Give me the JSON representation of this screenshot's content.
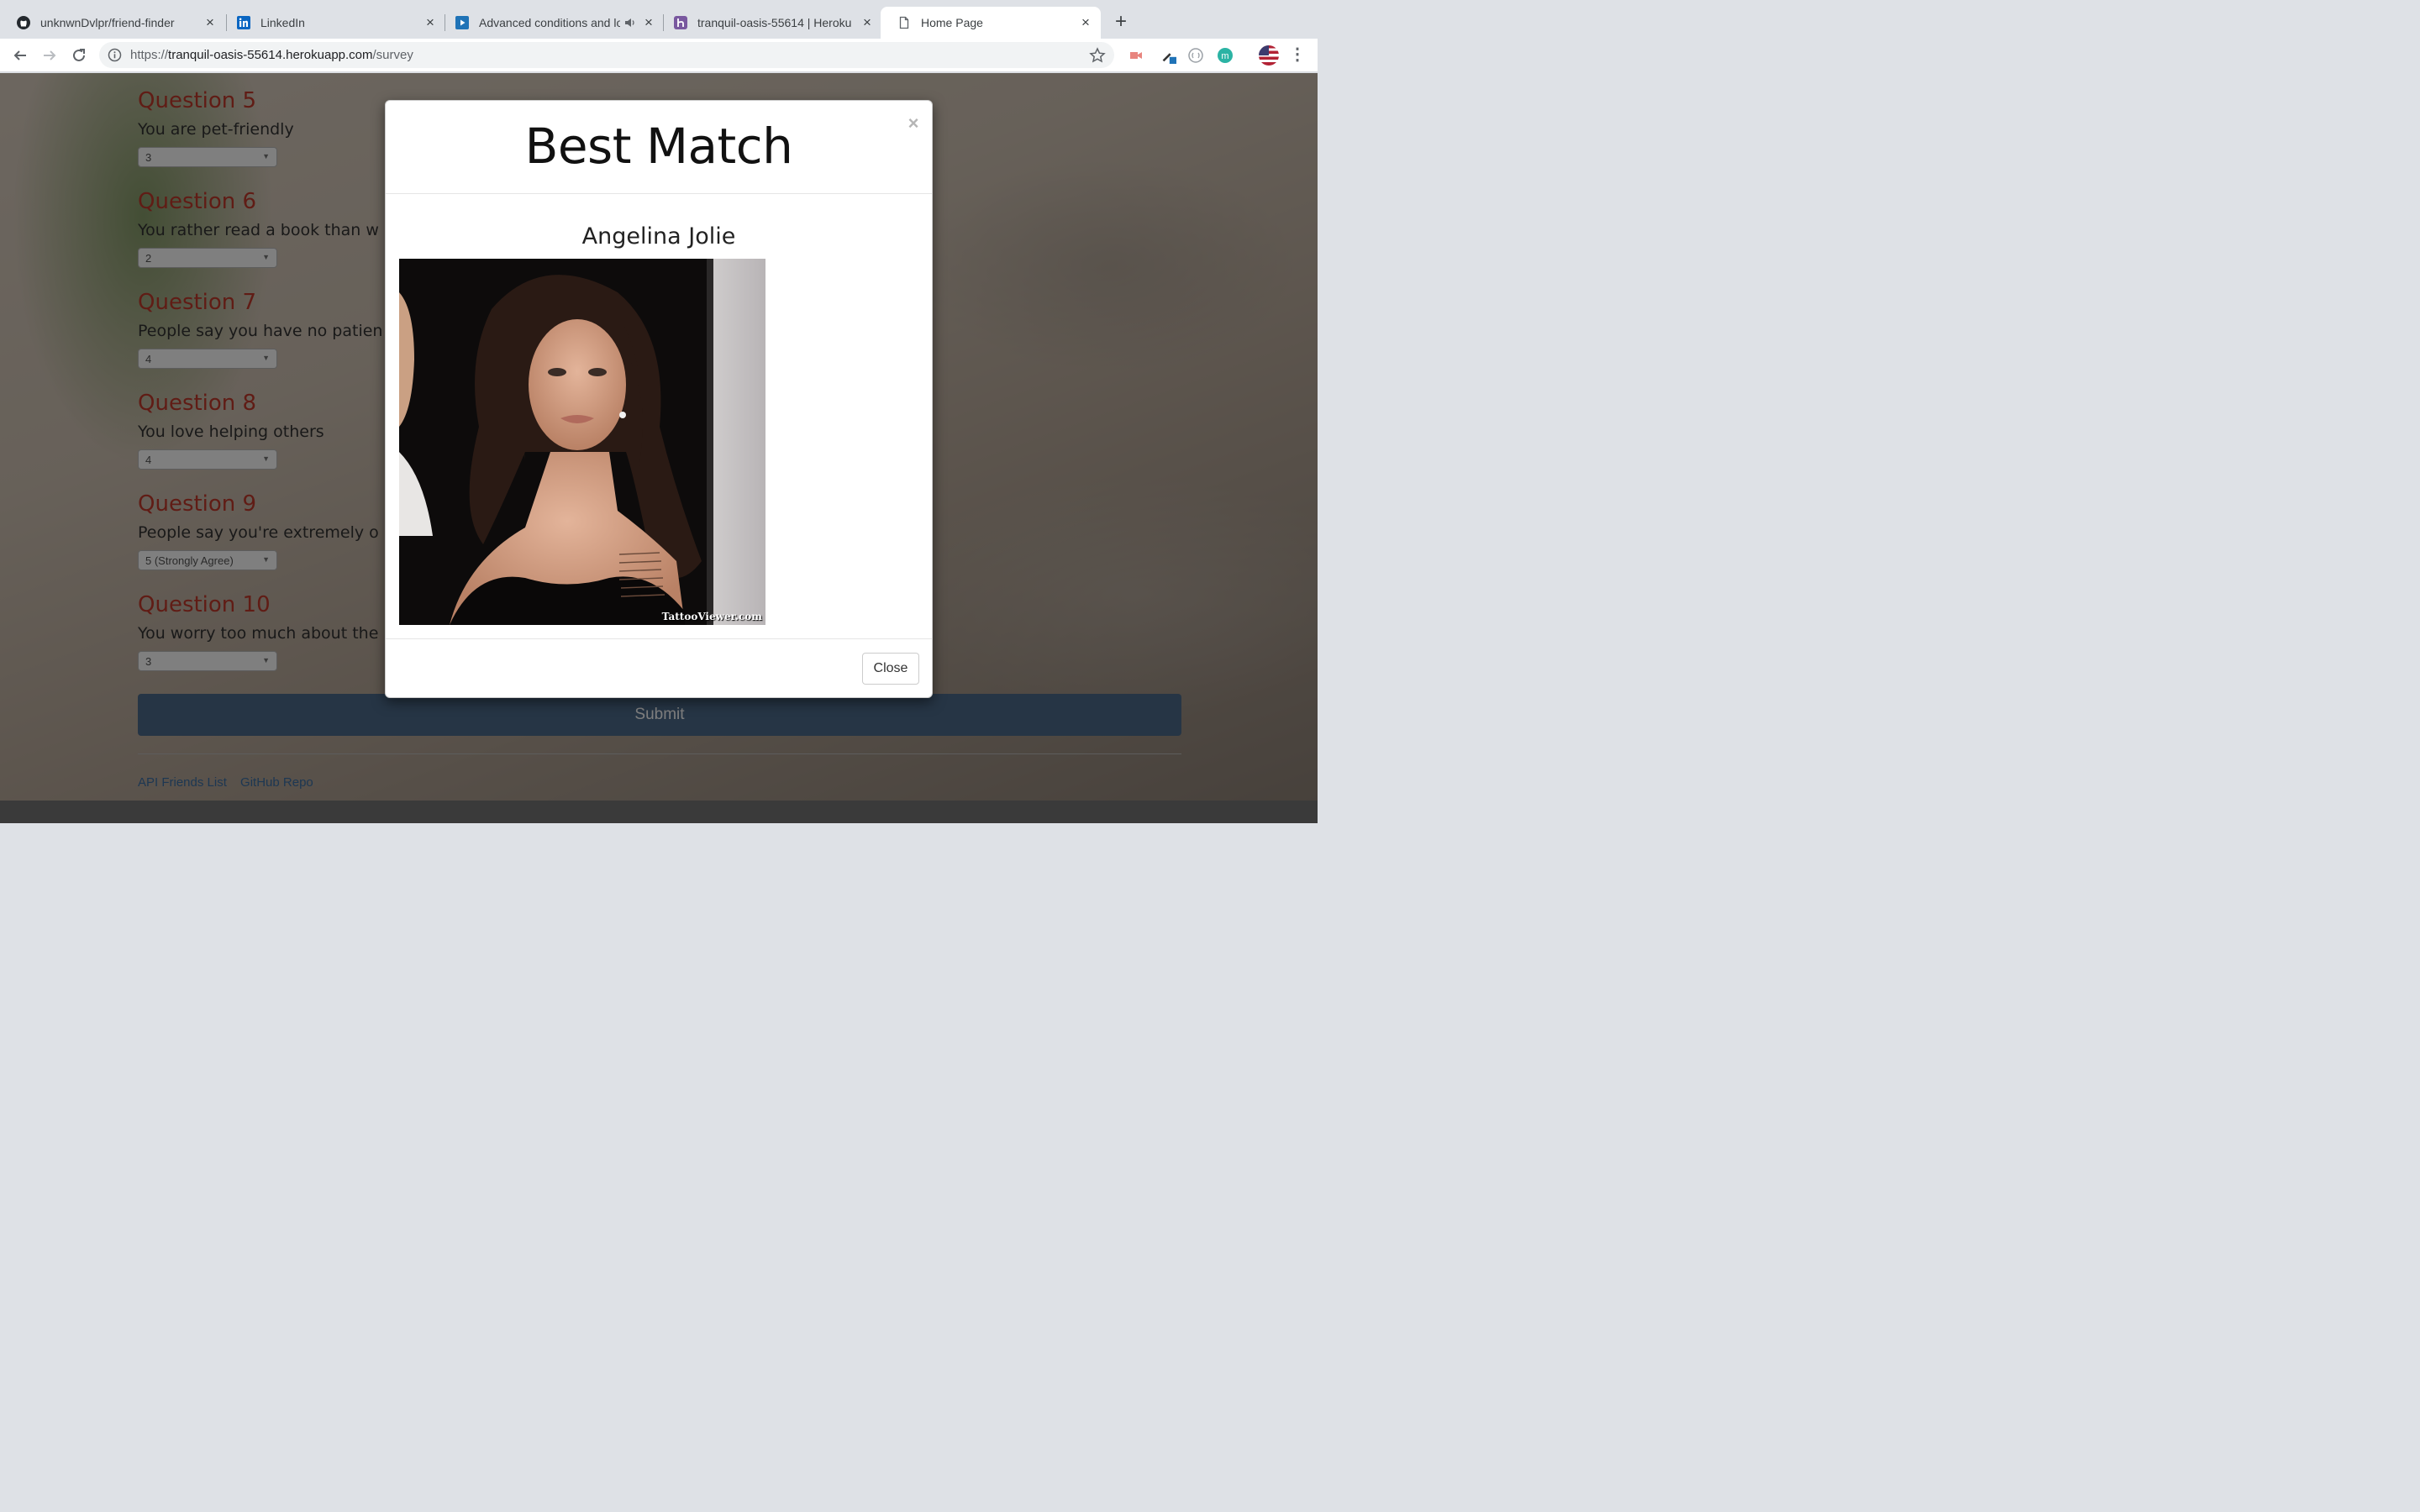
{
  "browser": {
    "tabs": [
      {
        "title": "unknwnDvlpr/friend-finder",
        "favicon": "github-icon"
      },
      {
        "title": "LinkedIn",
        "favicon": "linkedin-icon"
      },
      {
        "title": "Advanced conditions and lo",
        "favicon": "video-icon",
        "audio": "speaker-icon"
      },
      {
        "title": "tranquil-oasis-55614 | Heroku",
        "favicon": "heroku-icon"
      },
      {
        "title": "Home Page",
        "favicon": "page-icon",
        "active": true
      }
    ],
    "url_scheme": "https://",
    "url_host": "tranquil-oasis-55614.herokuapp.com",
    "url_path": "/survey"
  },
  "survey": {
    "questions": [
      {
        "title": "Question 5",
        "text": "You are pet-friendly",
        "value": "3"
      },
      {
        "title": "Question 6",
        "text": "You rather read a book than w",
        "value": "2"
      },
      {
        "title": "Question 7",
        "text": "People say you have no patien",
        "value": "4"
      },
      {
        "title": "Question 8",
        "text": "You love helping others",
        "value": "4"
      },
      {
        "title": "Question 9",
        "text": "People say you're extremely o",
        "value": "5 (Strongly Agree)"
      },
      {
        "title": "Question 10",
        "text": "You worry too much about the",
        "value": "3"
      }
    ],
    "submit_label": "Submit",
    "footer_api": "API Friends List",
    "footer_repo": "GitHub Repo"
  },
  "modal": {
    "title": "Best Match",
    "close_x": "×",
    "match_name": "Angelina Jolie",
    "photo_watermark": "TattooViewer.com",
    "close_label": "Close"
  },
  "colors": {
    "question_title": "#c0392b",
    "submit_bg": "#4c6a8a",
    "modal_bg": "#ffffff"
  }
}
